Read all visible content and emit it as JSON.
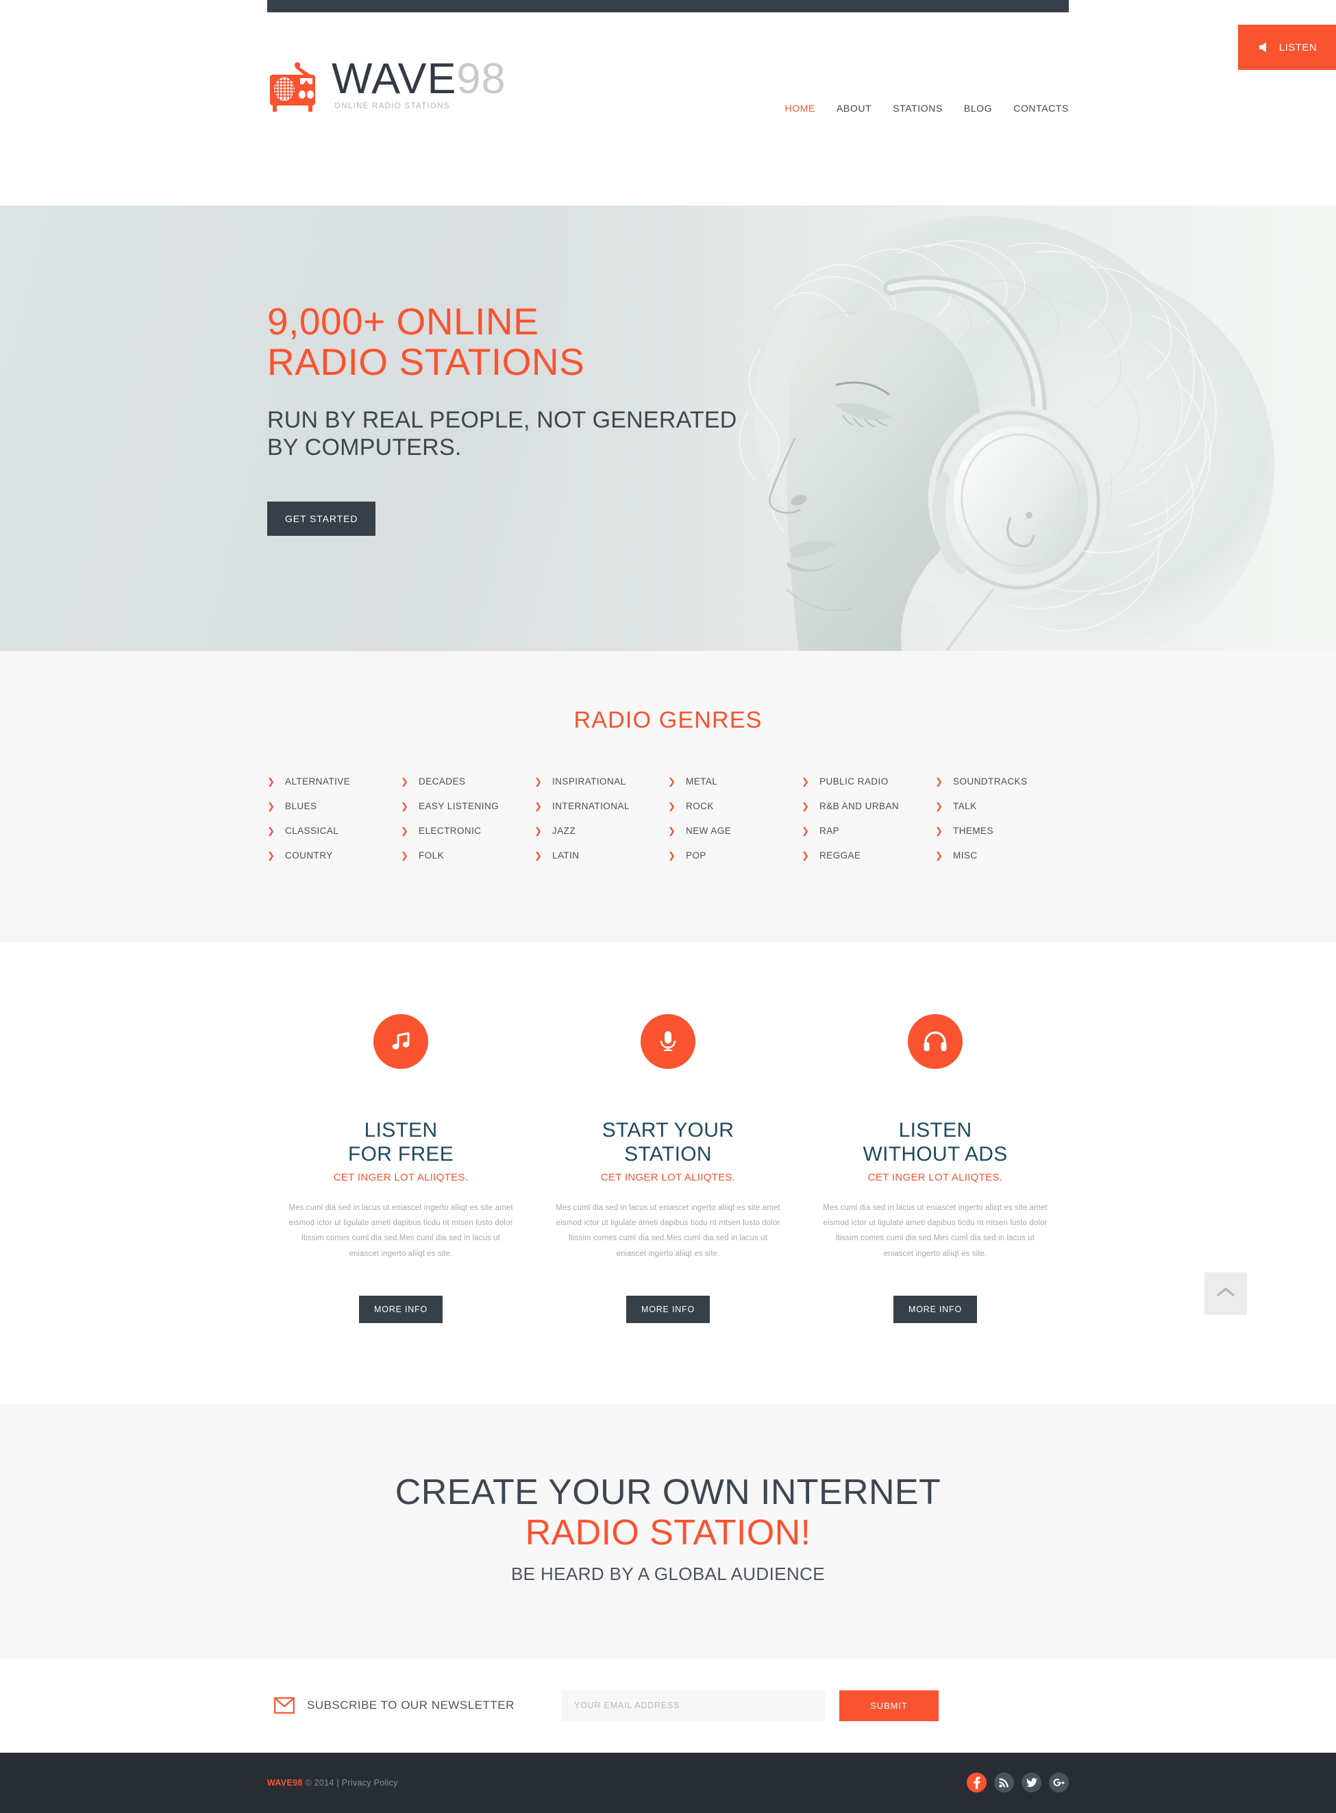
{
  "brand": {
    "name_part1": "WAVE",
    "name_part2": "98",
    "tagline": "ONLINE RADIO STATIONS",
    "accent_color": "#f9532f",
    "dark_color": "#373f48"
  },
  "topbar": {
    "listen_label": "LISTEN",
    "listen_icon": "speaker-icon"
  },
  "nav": {
    "items": [
      {
        "label": "HOME",
        "active": true
      },
      {
        "label": "ABOUT",
        "active": false
      },
      {
        "label": "STATIONS",
        "active": false
      },
      {
        "label": "BLOG",
        "active": false
      },
      {
        "label": "CONTACTS",
        "active": false
      }
    ]
  },
  "hero": {
    "title_line1": "9,000+ ONLINE",
    "title_line2": "RADIO STATIONS",
    "subtitle_line1": "RUN BY REAL PEOPLE, NOT GENERATED",
    "subtitle_line2": "BY COMPUTERS.",
    "button_label": "GET STARTED",
    "image_alt": "woman-with-headphones-photo"
  },
  "genres": {
    "title": "RADIO GENRES",
    "columns": [
      [
        "ALTERNATIVE",
        "BLUES",
        "CLASSICAL",
        "COUNTRY"
      ],
      [
        "DECADES",
        "EASY LISTENING",
        "ELECTRONIC",
        "FOLK"
      ],
      [
        "INSPIRATIONAL",
        "INTERNATIONAL",
        "JAZZ",
        "LATIN"
      ],
      [
        "METAL",
        "ROCK",
        "NEW AGE",
        "POP"
      ],
      [
        "PUBLIC RADIO",
        "R&B AND URBAN",
        "RAP",
        "REGGAE"
      ],
      [
        "SOUNDTRACKS",
        "TALK",
        "THEMES",
        "MISC"
      ]
    ]
  },
  "features": {
    "body_text": "Mes cuml dia sed in lacus ut eniascet ingerto aliiqt es site amet eismod ictor ut ligulate ameti dapibus ticdu nt mtsen lusto dolor ltissim comes cuml dia sed.Mes cuml dia sed in lacus ut eniascet ingerto aliiqt es site.",
    "button_label": "MORE INFO",
    "items": [
      {
        "icon": "music-note-icon",
        "title_line1": "LISTEN",
        "title_line2": "FOR FREE",
        "tagline": "CET INGER LOT ALIIQTES."
      },
      {
        "icon": "microphone-icon",
        "title_line1": "START YOUR",
        "title_line2": "STATION",
        "tagline": "CET INGER LOT ALIIQTES."
      },
      {
        "icon": "headphones-icon",
        "title_line1": "LISTEN",
        "title_line2": "WITHOUT ADS",
        "tagline": "CET INGER LOT ALIIQTES."
      }
    ],
    "scroll_top_icon": "chevron-up-icon"
  },
  "cta": {
    "line1": "CREATE YOUR OWN INTERNET",
    "line2": "RADIO STATION!",
    "line3": "BE HEARD BY A GLOBAL AUDIENCE"
  },
  "newsletter": {
    "icon": "envelope-icon",
    "label": "SUBSCRIBE TO OUR NEWSLETTER",
    "placeholder": "YOUR EMAIL ADDRESS",
    "value": "",
    "submit_label": "SUBMIT"
  },
  "footer": {
    "brand": "WAVE98",
    "copyright": "© 2014 |",
    "privacy_label": "Privacy Policy",
    "socials": [
      {
        "name": "facebook-icon",
        "active": true
      },
      {
        "name": "rss-icon",
        "active": false
      },
      {
        "name": "twitter-icon",
        "active": false
      },
      {
        "name": "google-plus-icon",
        "active": false
      }
    ]
  }
}
